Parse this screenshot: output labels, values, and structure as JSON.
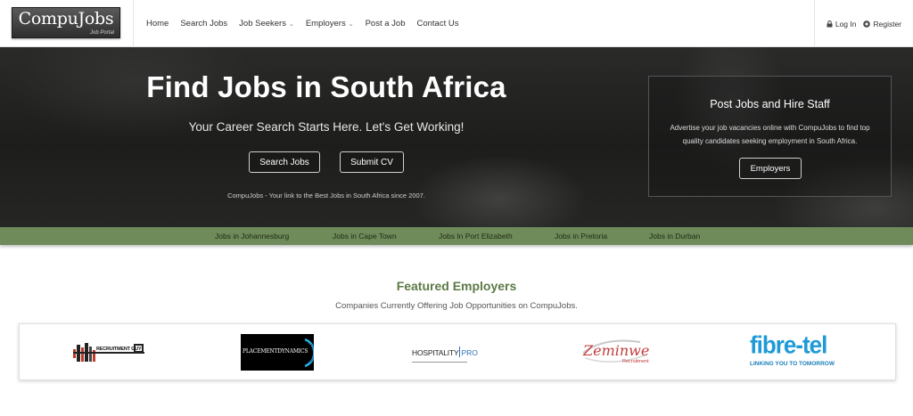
{
  "header": {
    "logo_text": "CompuJobs",
    "logo_subtext": "Job Portal",
    "nav": [
      {
        "label": "Home"
      },
      {
        "label": "Search Jobs"
      },
      {
        "label": "Job Seekers",
        "dropdown": true
      },
      {
        "label": "Employers",
        "dropdown": true
      },
      {
        "label": "Post a Job"
      },
      {
        "label": "Contact Us"
      }
    ],
    "login_label": "Log In",
    "register_label": "Register",
    "icons": {
      "login": "lock-icon",
      "register": "plus-circle-icon",
      "dropdown": "chevron-down-icon"
    }
  },
  "hero": {
    "title": "Find Jobs in South Africa",
    "subtitle": "Your Career Search Starts Here. Let's Get Working!",
    "search_button": "Search Jobs",
    "submit_cv_button": "Submit CV",
    "tagline": "CompuJobs - Your link to the Best Jobs in South Africa since 2007."
  },
  "post_box": {
    "title": "Post Jobs and Hire Staff",
    "text": "Advertise your job vacancies online with CompuJobs to find top quality candidates seeking employment in South Africa.",
    "button": "Employers"
  },
  "city_links": [
    "Jobs in Johannesburg",
    "Jobs in Cape Town",
    "Jobs In Port Elizabeth",
    "Jobs in Pretoria",
    "Jobs in Durban"
  ],
  "featured": {
    "title": "Featured Employers",
    "subtitle": "Companies Currently Offering Job Opportunities on CompuJobs.",
    "employers": [
      {
        "name": "RECRUITMENT GUY",
        "subtext": "",
        "icon": "building-logo"
      },
      {
        "name": "PLACEMENTDYNAMICS"
      },
      {
        "name": "HOSPITALITY",
        "suffix": "PRO"
      },
      {
        "name": "Zeminwe",
        "subtext": "Recruitment"
      },
      {
        "name": "fibre-tel",
        "tagline": "LINKING YOU TO TOMORROW"
      }
    ]
  },
  "colors": {
    "green_bar": "#6f8b5a",
    "featured_title": "#5c7a45",
    "fibretel_blue": "#1f9ad6",
    "zeminwe_red": "#c33b3b"
  }
}
